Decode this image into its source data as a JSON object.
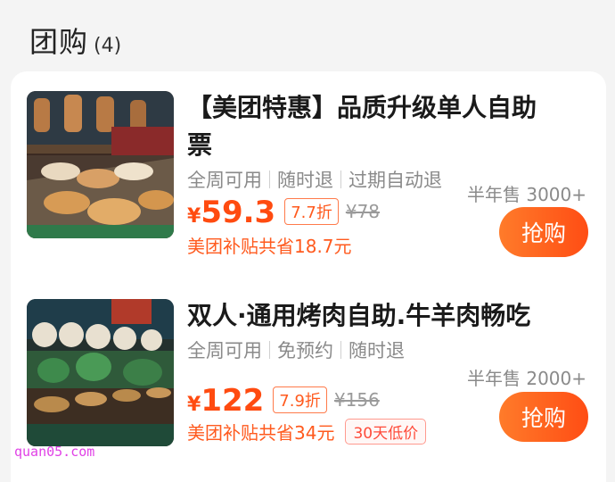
{
  "header": {
    "title": "团购",
    "count": "(4)"
  },
  "deals": [
    {
      "title": "【美团特惠】品质升级单人自助票",
      "tags": [
        "全周可用",
        "随时退",
        "过期自动退"
      ],
      "currency": "¥",
      "price": "59.3",
      "discount": "7.7折",
      "original_price": "¥78",
      "saving": "美团补贴共省18.7元",
      "sales": "半年售 3000+",
      "buy_label": "抢购"
    },
    {
      "title": "双人·通用烤肉自助.牛羊肉畅吃",
      "tags": [
        "全周可用",
        "免预约",
        "随时退"
      ],
      "currency": "¥",
      "price": "122",
      "discount": "7.9折",
      "original_price": "¥156",
      "saving": "美团补贴共省34元",
      "badge": "30天低价",
      "sales": "半年售 2000+",
      "buy_label": "抢购"
    }
  ],
  "watermark": "quan05.com",
  "colors": {
    "accent": "#ff4b10",
    "button_start": "#ff7b2a",
    "button_end": "#ff4d14"
  }
}
